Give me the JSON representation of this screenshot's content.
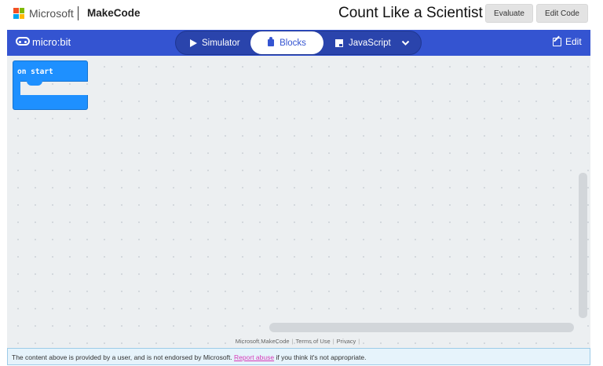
{
  "header": {
    "brand": "Microsoft",
    "product": "MakeCode",
    "project_title": "Count Like a Scientist",
    "buttons": {
      "evaluate": "Evaluate",
      "edit_code": "Edit Code"
    },
    "logo_colors": [
      "#f25022",
      "#7fba00",
      "#00a4ef",
      "#ffb900"
    ]
  },
  "appbar": {
    "logo_text": "micro:bit",
    "tabs": {
      "simulator": "Simulator",
      "blocks": "Blocks",
      "javascript": "JavaScript"
    },
    "active_tab": "Blocks",
    "edit_label": "Edit",
    "accent": "#3454d1"
  },
  "workspace": {
    "block_label": "on start",
    "block_color": "#1e90ff"
  },
  "footer": {
    "links": [
      "Microsoft MakeCode",
      "Terms of Use",
      "Privacy"
    ]
  },
  "disclaimer": {
    "before": "The content above is provided by a user, and is not endorsed by Microsoft.",
    "link": "Report abuse",
    "after": "if you think it's not appropriate."
  }
}
